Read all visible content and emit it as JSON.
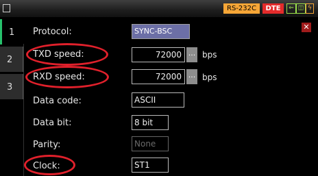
{
  "status": {
    "interface": "RS-232C",
    "mode": "DTE"
  },
  "tabs": [
    {
      "label": "1"
    },
    {
      "label": "2"
    },
    {
      "label": "3"
    }
  ],
  "fields": {
    "protocol": {
      "label": "Protocol:",
      "value": "SYNC-BSC"
    },
    "txd_speed": {
      "label": "TXD speed:",
      "value": "72000",
      "unit": "bps",
      "more": "..."
    },
    "rxd_speed": {
      "label": "RXD speed:",
      "value": "72000",
      "unit": "bps",
      "more": "..."
    },
    "data_code": {
      "label": "Data code:",
      "value": "ASCII"
    },
    "data_bit": {
      "label": "Data bit:",
      "value": "8 bit"
    },
    "parity": {
      "label": "Parity:",
      "value": "None"
    },
    "clock": {
      "label": "Clock:",
      "value": "ST1"
    }
  },
  "colors": {
    "highlight": "#e0202b",
    "tab_accent": "#27c16c",
    "dte": "#e32b2b",
    "rs": "#f6a637"
  },
  "icons": [
    "window-icon",
    "send-icon",
    "receive-icon",
    "panel-icon",
    "power-icon",
    "close-icon"
  ]
}
